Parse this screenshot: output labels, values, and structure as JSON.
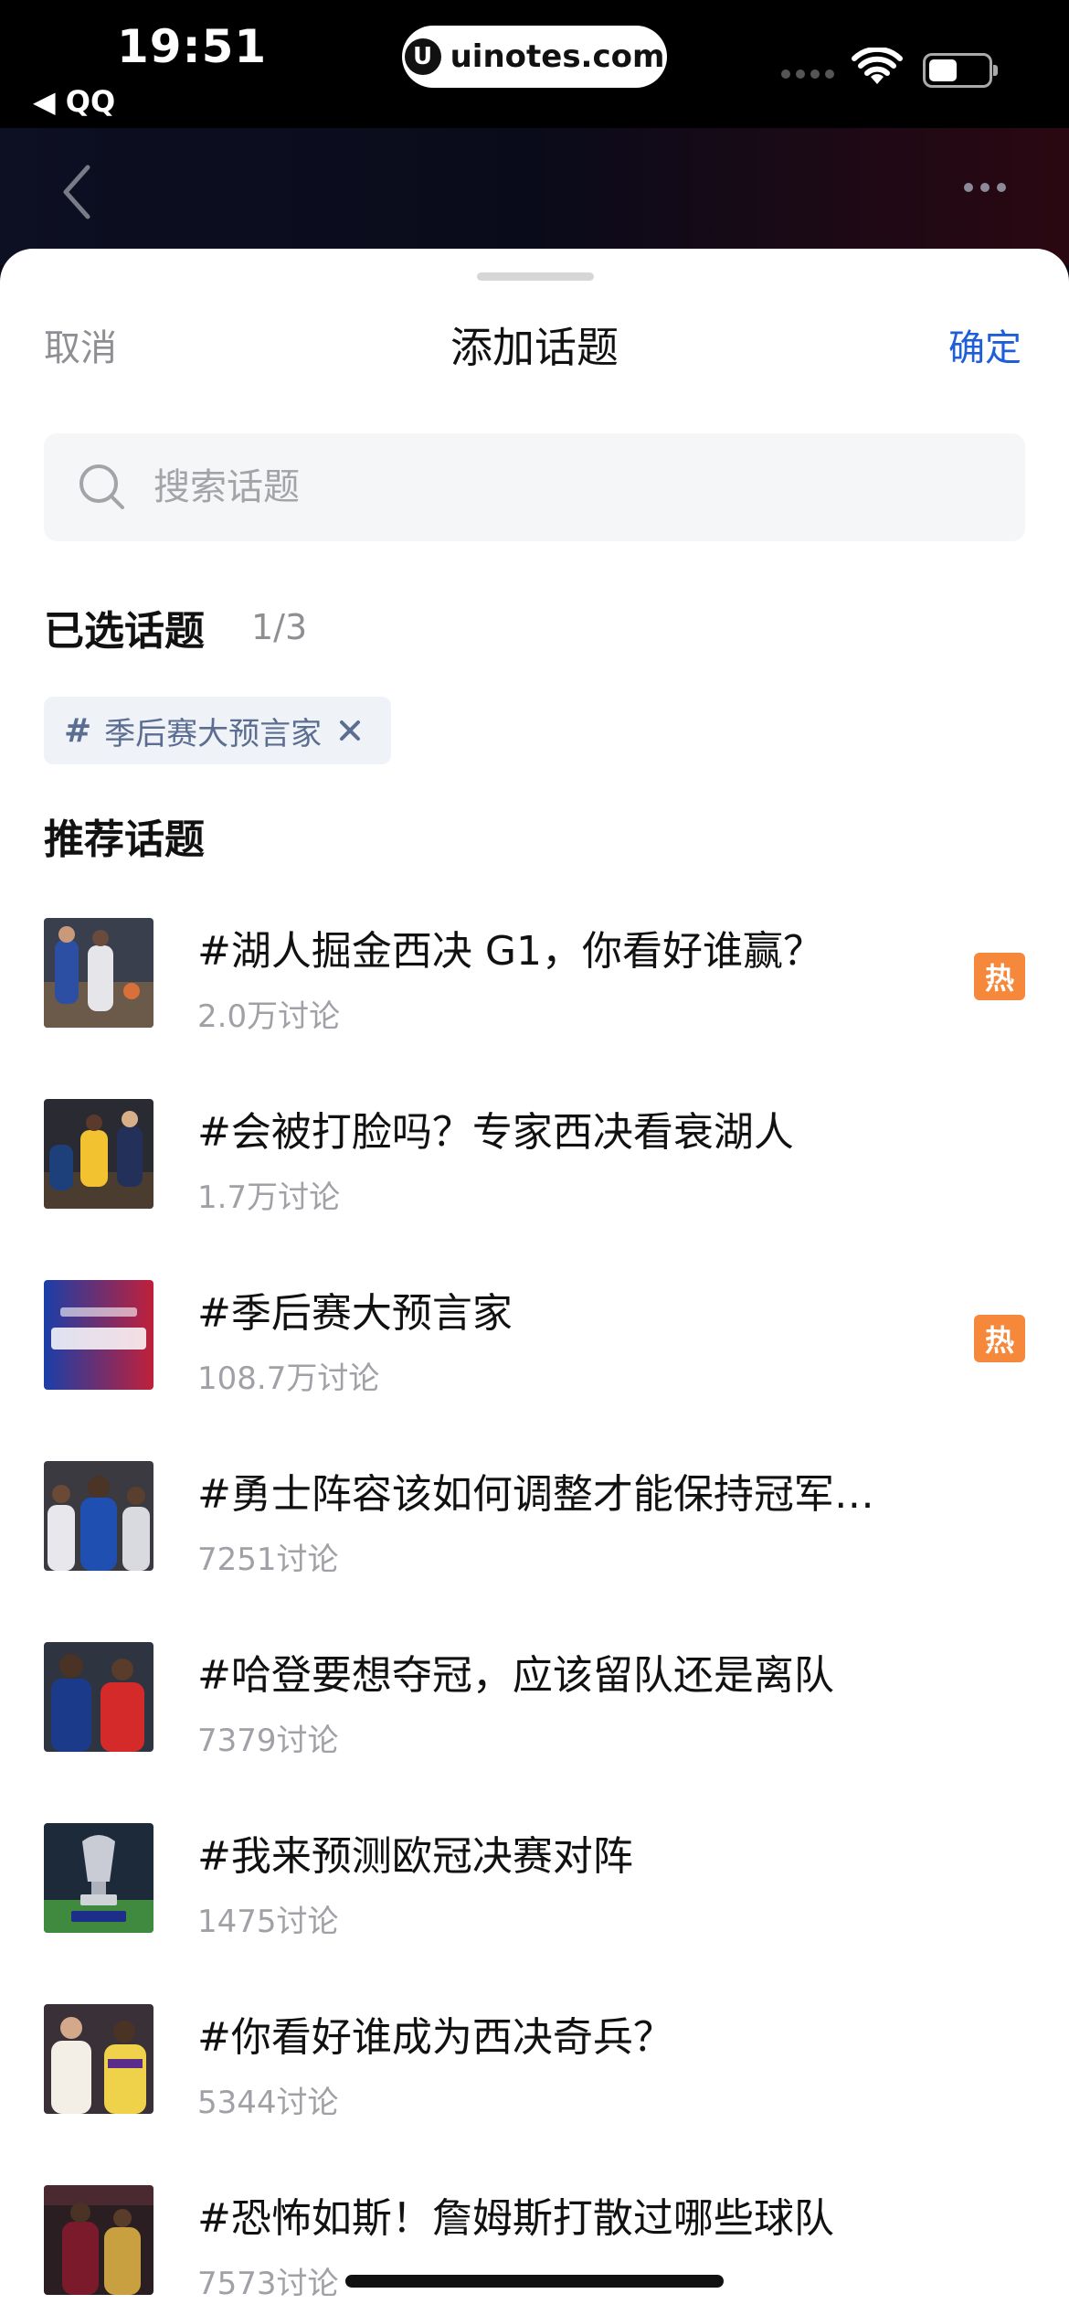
{
  "status_bar": {
    "time": "19:51",
    "back_app": "◀ QQ",
    "url": "uinotes.com",
    "url_logo": "U"
  },
  "sheet": {
    "cancel_label": "取消",
    "title": "添加话题",
    "confirm_label": "确定",
    "search_placeholder": "搜索话题",
    "selected_title": "已选话题",
    "selected_count": "1/3",
    "selected_chip": {
      "hash": "#",
      "label": "季后赛大预言家"
    },
    "recommended_title": "推荐话题",
    "hot_label": "热",
    "topics": [
      {
        "title": "#湖人掘金西决 G1，你看好谁赢？",
        "count": "2.0万讨论",
        "hot": true
      },
      {
        "title": "#会被打脸吗？专家西决看衰湖人",
        "count": "1.7万讨论",
        "hot": false
      },
      {
        "title": "#季后赛大预言家",
        "count": "108.7万讨论",
        "hot": true
      },
      {
        "title": "#勇士阵容该如何调整才能保持冠军…",
        "count": "7251讨论",
        "hot": false
      },
      {
        "title": "#哈登要想夺冠，应该留队还是离队",
        "count": "7379讨论",
        "hot": false
      },
      {
        "title": "#我来预测欧冠决赛对阵",
        "count": "1475讨论",
        "hot": false
      },
      {
        "title": "#你看好谁成为西决奇兵？",
        "count": "5344讨论",
        "hot": false
      },
      {
        "title": "#恐怖如斯！詹姆斯打散过哪些球队",
        "count": "7573讨论",
        "hot": false
      }
    ]
  },
  "colors": {
    "accent_blue": "#1e5fd8",
    "hot_orange": "#f5883b",
    "chip_text": "#5b6d91"
  }
}
